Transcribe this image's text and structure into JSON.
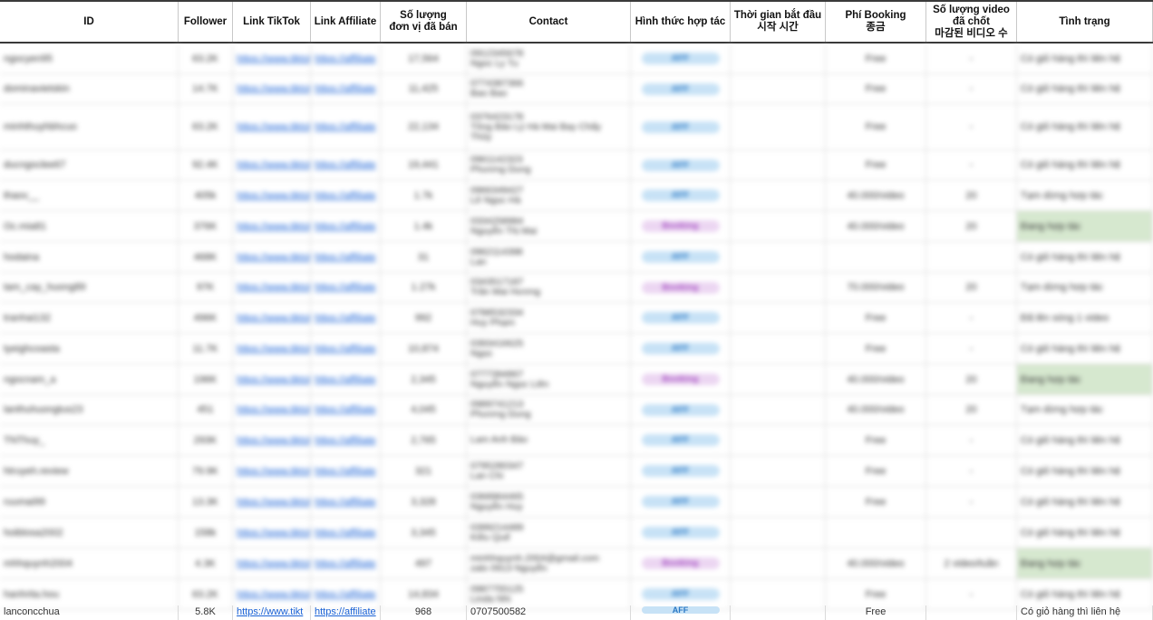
{
  "columns": [
    {
      "key": "id",
      "label": "ID"
    },
    {
      "key": "follower",
      "label": "Follower"
    },
    {
      "key": "tiktok",
      "label": "Link TikTok"
    },
    {
      "key": "affiliate",
      "label": "Link Affiliate"
    },
    {
      "key": "sold",
      "label": "Số lượng\nđơn vị đã bán"
    },
    {
      "key": "contact",
      "label": "Contact"
    },
    {
      "key": "type",
      "label": "Hình thức hợp tác"
    },
    {
      "key": "start",
      "label": "Thời gian bắt đầu\n시작 시간"
    },
    {
      "key": "fee",
      "label": "Phí Booking\n종금"
    },
    {
      "key": "videos",
      "label": "Số lượng video\nđã chốt\n마감된 비디오 수"
    },
    {
      "key": "status",
      "label": "Tình trạng"
    }
  ],
  "rows": [
    {
      "id": "ngocyen95",
      "follower": "63.2K",
      "tiktok": "https://www.tiktok",
      "affiliate": "https://affiliate",
      "sold": "17,564",
      "contact": [
        "0912345678",
        "Ngoc Ly Tu"
      ],
      "type": "AFF",
      "type_kind": "aff",
      "start": "",
      "fee": "Free",
      "videos": "-",
      "status": "Có giỏ hàng thì liên hệ",
      "status_kind": "plain"
    },
    {
      "id": "dominavietskin",
      "follower": "14.7K",
      "tiktok": "https://www.tiktok",
      "affiliate": "https://affiliate",
      "sold": "11,425",
      "contact": [
        "0774387366",
        "Bao Bao"
      ],
      "type": "AFF",
      "type_kind": "aff",
      "start": "",
      "fee": "Free",
      "videos": "-",
      "status": "Có giỏ hàng thì liên hệ",
      "status_kind": "plain"
    },
    {
      "id": "minhthuyhbhcuo",
      "follower": "63.2K",
      "tiktok": "https://www.tiktok",
      "affiliate": "https://affiliate",
      "sold": "22,134",
      "contact": [
        "0376423178",
        "Tông Bảo Lý Hà Mai Bay Chấy",
        "Thủy"
      ],
      "type": "AFF",
      "type_kind": "aff",
      "start": "",
      "fee": "Free",
      "videos": "-",
      "status": "Có giỏ hàng thì liên hệ",
      "status_kind": "plain"
    },
    {
      "id": "ducngoclee67",
      "follower": "92.4K",
      "tiktok": "https://www.tiktok",
      "affiliate": "https://affiliate",
      "sold": "19,441",
      "contact": [
        "0961142323",
        "Phương Dung"
      ],
      "type": "AFF",
      "type_kind": "aff",
      "start": "",
      "fee": "Free",
      "videos": "-",
      "status": "Có giỏ hàng thì liên hệ",
      "status_kind": "plain"
    },
    {
      "id": "thaov__",
      "follower": "405k",
      "tiktok": "https://www.tiktok",
      "affiliate": "https://affiliate",
      "sold": "1.7k",
      "contact": [
        "0966349427",
        "Lê Ngọc Hà"
      ],
      "type": "AFF",
      "type_kind": "aff",
      "start": "",
      "fee": "40.000/video",
      "videos": "20",
      "status": "Tạm dừng hợp tác",
      "status_kind": "plain"
    },
    {
      "id": "Oc.mia81",
      "follower": "376K",
      "tiktok": "https://www.tiktok",
      "affiliate": "https://affiliate",
      "sold": "1.4k",
      "contact": [
        "0334258984",
        "Nguyễn Thị Mai"
      ],
      "type": "Booking",
      "type_kind": "book",
      "start": "",
      "fee": "40.000/video",
      "videos": "20",
      "status": "Đang hợp tác",
      "status_kind": "green"
    },
    {
      "id": "hodaina",
      "follower": "468K",
      "tiktok": "https://www.tiktok",
      "affiliate": "https://affiliate",
      "sold": "31",
      "contact": [
        "0962114398",
        "Lan"
      ],
      "type": "AFF",
      "type_kind": "aff",
      "start": "",
      "fee": "",
      "videos": "",
      "status": "Có giỏ hàng thì liên hệ",
      "status_kind": "plain"
    },
    {
      "id": "tam_cay_huong89",
      "follower": "97K",
      "tiktok": "https://www.tiktok",
      "affiliate": "https://affiliate",
      "sold": "1.27k",
      "contact": [
        "0343517187",
        "Trần Mai Hương"
      ],
      "type": "Booking",
      "type_kind": "book",
      "start": "",
      "fee": "70.000/video",
      "videos": "20",
      "status": "Tạm dừng hợp tác",
      "status_kind": "plain"
    },
    {
      "id": "tranhai132",
      "follower": "496K",
      "tiktok": "https://www.tiktok",
      "affiliate": "https://affiliate",
      "sold": "992",
      "contact": [
        "0788532334",
        "Huy Phạm"
      ],
      "type": "AFF",
      "type_kind": "aff",
      "start": "",
      "fee": "Free",
      "videos": "-",
      "status": "Đã lên sóng 1 video",
      "status_kind": "plain"
    },
    {
      "id": "tyeighcoasta",
      "follower": "11.7K",
      "tiktok": "https://www.tiktok",
      "affiliate": "https://affiliate",
      "sold": "10,874",
      "contact": [
        "0393416625",
        "Ngọc"
      ],
      "type": "AFF",
      "type_kind": "aff",
      "start": "",
      "fee": "Free",
      "videos": "-",
      "status": "Có giỏ hàng thì liên hệ",
      "status_kind": "plain"
    },
    {
      "id": "ngocnam_a",
      "follower": "196K",
      "tiktok": "https://www.tiktok",
      "affiliate": "https://affiliate",
      "sold": "2,345",
      "contact": [
        "0777394867",
        "Nguyễn Ngọc Liên"
      ],
      "type": "Booking",
      "type_kind": "book",
      "start": "",
      "fee": "40.000/video",
      "videos": "20",
      "status": "Đang hợp tác",
      "status_kind": "green"
    },
    {
      "id": "lanthuhuongtus23",
      "follower": "451",
      "tiktok": "https://www.tiktok",
      "affiliate": "https://affiliate",
      "sold": "4,045",
      "contact": [
        "0989741213",
        "Phương Dung"
      ],
      "type": "AFF",
      "type_kind": "aff",
      "start": "",
      "fee": "40.000/video",
      "videos": "20",
      "status": "Tạm dừng hợp tác",
      "status_kind": "plain"
    },
    {
      "id": "TNThuy_",
      "follower": "293K",
      "tiktok": "https://www.tiktok",
      "affiliate": "https://affiliate",
      "sold": "2,765",
      "contact": [
        "Lam Anh Bảo"
      ],
      "type": "AFF",
      "type_kind": "aff",
      "start": "",
      "fee": "Free",
      "videos": "-",
      "status": "Có giỏ hàng thì liên hệ",
      "status_kind": "plain"
    },
    {
      "id": "htruyeh.review",
      "follower": "79.9K",
      "tiktok": "https://www.tiktok",
      "affiliate": "https://affiliate",
      "sold": "321",
      "contact": [
        "0795280347",
        "Lan Chi"
      ],
      "type": "AFF",
      "type_kind": "aff",
      "start": "",
      "fee": "Free",
      "videos": "-",
      "status": "Có giỏ hàng thì liên hệ",
      "status_kind": "plain"
    },
    {
      "id": "ruumai99",
      "follower": "13.3K",
      "tiktok": "https://www.tiktok",
      "affiliate": "https://affiliate",
      "sold": "3,328",
      "contact": [
        "0368964465",
        "Nguyễn Huy"
      ],
      "type": "AFF",
      "type_kind": "aff",
      "start": "",
      "fee": "Free",
      "videos": "-",
      "status": "Có giỏ hàng thì liên hệ",
      "status_kind": "plain"
    },
    {
      "id": "hoiblosa2002",
      "follower": "158k",
      "tiktok": "https://www.tiktok",
      "affiliate": "https://affiliate",
      "sold": "3,345",
      "contact": [
        "0399214489",
        "Kiều Quế"
      ],
      "type": "AFF",
      "type_kind": "aff",
      "start": "",
      "fee": "",
      "videos": "",
      "status": "Có giỏ hàng thì liên hệ",
      "status_kind": "plain"
    },
    {
      "id": "mhhquynh2004",
      "follower": "4.3K",
      "tiktok": "https://www.tiktok",
      "affiliate": "https://affiliate",
      "sold": "497",
      "contact": [
        "minhhquynh.2004@gmail.com",
        "zalo 0913 Nguyễn"
      ],
      "type": "Booking",
      "type_kind": "book",
      "start": "",
      "fee": "40.000/video",
      "videos": "2 video/tuần",
      "status": "Đang hợp tác",
      "status_kind": "green"
    },
    {
      "id": "hanhrita.hou",
      "follower": "63.2K",
      "tiktok": "https://www.tiktok",
      "affiliate": "https://affiliate",
      "sold": "14,834",
      "contact": [
        "0987755125",
        "Linda Nhi"
      ],
      "type": "AFF",
      "type_kind": "aff",
      "start": "",
      "fee": "Free",
      "videos": "-",
      "status": "Có giỏ hàng thì liên hệ",
      "status_kind": "plain"
    }
  ],
  "last_row": {
    "id": "lanconcchua",
    "follower": "5.8K",
    "tiktok": "https://www.tikt",
    "affiliate": "https://affiliate",
    "sold": "968",
    "contact": "0707500582",
    "type": "AFF",
    "start": "",
    "fee": "Free",
    "videos": "",
    "status": "Có giỏ hàng thì liên hệ"
  }
}
